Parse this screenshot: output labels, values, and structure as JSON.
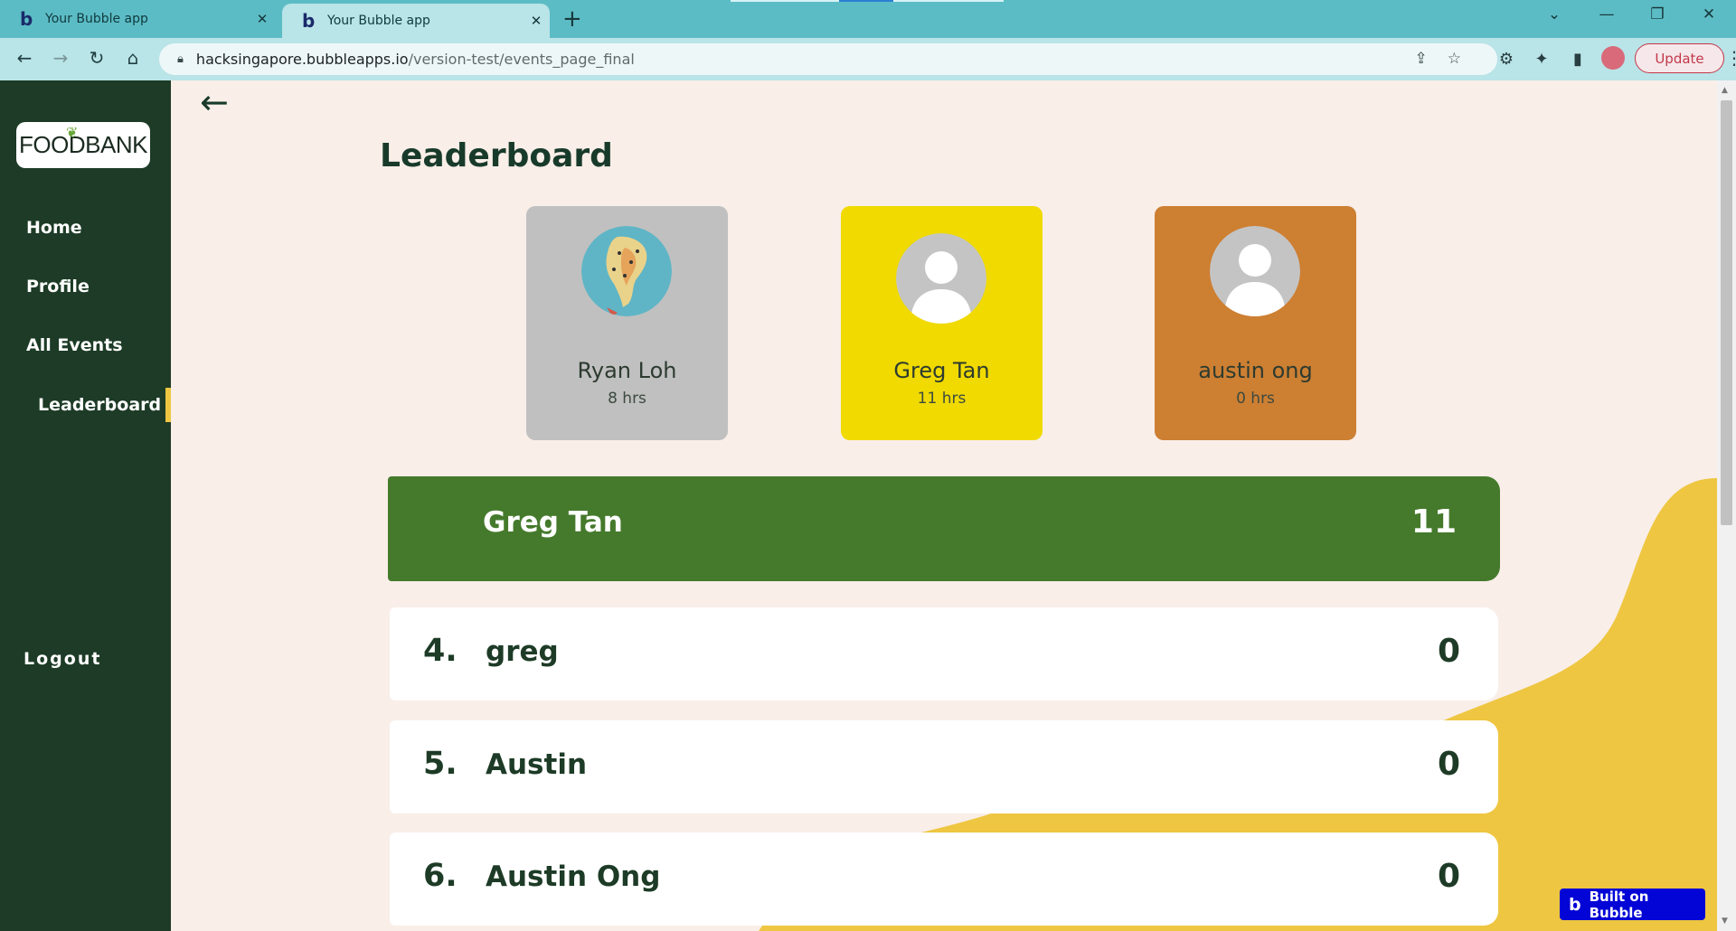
{
  "browser": {
    "tabs": [
      {
        "title": "Your Bubble app",
        "favicon": "b",
        "active": false
      },
      {
        "title": "Your Bubble app",
        "favicon": "b",
        "active": true
      }
    ],
    "new_tab_label": "+",
    "url_host": "hacksingapore.bubbleapps.io",
    "url_path": "/version-test/events_page_final",
    "update_label": "Update",
    "window_controls": {
      "tab_search": "⌄",
      "minimize": "—",
      "restore": "❐",
      "close": "✕"
    },
    "nav": {
      "back": "←",
      "forward": "→",
      "reload": "↻",
      "home": "⌂"
    }
  },
  "sidebar": {
    "logo_text": "FOODBANK",
    "items": [
      {
        "label": "Home"
      },
      {
        "label": "Profile"
      },
      {
        "label": "All Events"
      },
      {
        "label": "Leaderboard",
        "active": true
      }
    ],
    "logout_label": "Logout"
  },
  "page": {
    "back_icon": "←",
    "title": "Leaderboard"
  },
  "podium": [
    {
      "name": "Ryan Loh",
      "hours": "8 hrs",
      "color": "#c0c0c0",
      "avatar": "map-photo"
    },
    {
      "name": "Greg Tan",
      "hours": "11 hrs",
      "color": "#f0da00",
      "avatar": "default-user-icon"
    },
    {
      "name": "austin ong",
      "hours": "0 hrs",
      "color": "#cd7f32",
      "avatar": "default-user-icon"
    }
  ],
  "current_user": {
    "name": "Greg Tan",
    "score": "11"
  },
  "rankings": [
    {
      "rank": "4.",
      "name": "greg",
      "score": "0"
    },
    {
      "rank": "5.",
      "name": "Austin",
      "score": "0"
    },
    {
      "rank": "6.",
      "name": "Austin Ong",
      "score": "0"
    }
  ],
  "badge": {
    "label": "Built on Bubble",
    "icon": "b"
  },
  "colors": {
    "sidebar": "#1d3b26",
    "accent_yellow": "#eec641",
    "current_user_bar": "#457a2c",
    "page_bg": "#f9eee8",
    "tab_bar": "#5cbcc5",
    "toolbar": "#b9e4e8"
  }
}
